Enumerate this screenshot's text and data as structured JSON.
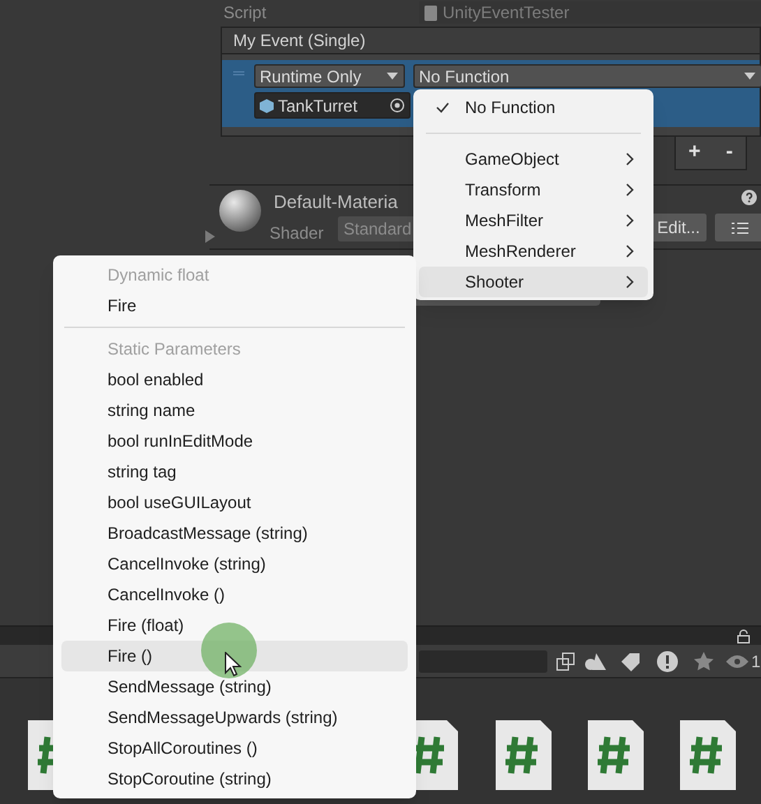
{
  "inspector": {
    "script_label": "Script",
    "script_value": "UnityEventTester",
    "event": {
      "title": "My Event (Single)",
      "call_state": "Runtime Only",
      "function": "No Function",
      "target": "TankTurret"
    },
    "add_button": "+",
    "remove_button": "-"
  },
  "material": {
    "name": "Default-Materia",
    "shader_label": "Shader",
    "shader": "Standard",
    "edit_button": "Edit..."
  },
  "project_panel": {
    "visibility_count": "1"
  },
  "function_menu": {
    "items": [
      {
        "kind": "item",
        "label": "No Function",
        "checked": true,
        "selected": false,
        "submenu": false
      },
      {
        "kind": "separator"
      },
      {
        "kind": "item",
        "label": "GameObject",
        "checked": false,
        "selected": false,
        "submenu": true
      },
      {
        "kind": "item",
        "label": "Transform",
        "checked": false,
        "selected": false,
        "submenu": true
      },
      {
        "kind": "item",
        "label": "MeshFilter",
        "checked": false,
        "selected": false,
        "submenu": true
      },
      {
        "kind": "item",
        "label": "MeshRenderer",
        "checked": false,
        "selected": false,
        "submenu": true
      },
      {
        "kind": "item",
        "label": "Shooter",
        "checked": false,
        "selected": true,
        "submenu": true
      }
    ]
  },
  "shooter_submenu": {
    "items": [
      {
        "kind": "header",
        "label": "Dynamic float"
      },
      {
        "kind": "item",
        "label": "Fire",
        "selected": false
      },
      {
        "kind": "separator"
      },
      {
        "kind": "header",
        "label": "Static Parameters"
      },
      {
        "kind": "item",
        "label": "bool enabled",
        "selected": false
      },
      {
        "kind": "item",
        "label": "string name",
        "selected": false
      },
      {
        "kind": "item",
        "label": "bool runInEditMode",
        "selected": false
      },
      {
        "kind": "item",
        "label": "string tag",
        "selected": false
      },
      {
        "kind": "item",
        "label": "bool useGUILayout",
        "selected": false
      },
      {
        "kind": "item",
        "label": "BroadcastMessage (string)",
        "selected": false
      },
      {
        "kind": "item",
        "label": "CancelInvoke (string)",
        "selected": false
      },
      {
        "kind": "item",
        "label": "CancelInvoke ()",
        "selected": false
      },
      {
        "kind": "item",
        "label": "Fire (float)",
        "selected": false
      },
      {
        "kind": "item",
        "label": "Fire ()",
        "selected": true
      },
      {
        "kind": "item",
        "label": "SendMessage (string)",
        "selected": false
      },
      {
        "kind": "item",
        "label": "SendMessageUpwards (string)",
        "selected": false
      },
      {
        "kind": "item",
        "label": "StopAllCoroutines ()",
        "selected": false
      },
      {
        "kind": "item",
        "label": "StopCoroutine (string)",
        "selected": false
      }
    ]
  }
}
